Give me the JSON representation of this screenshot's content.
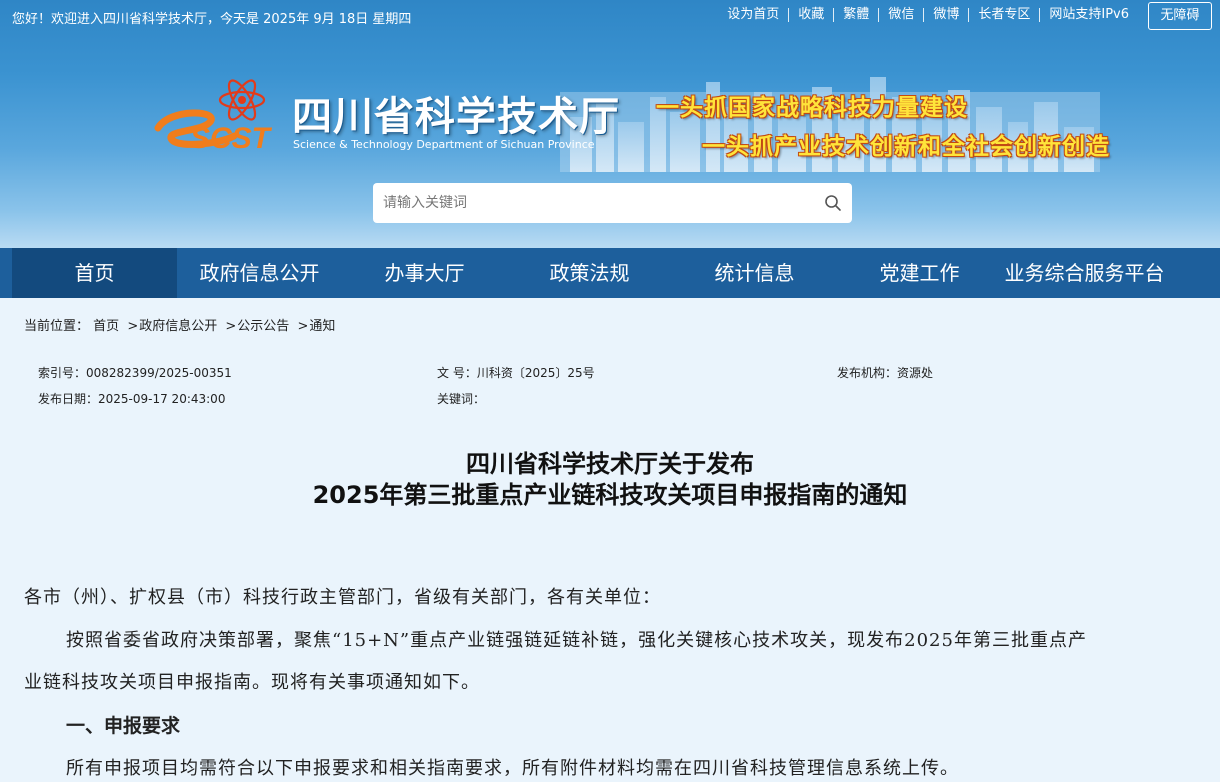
{
  "topbar": {
    "welcome": "您好！欢迎进入四川省科学技术厅，今天是  2025年 9月 18日  星期四",
    "links": [
      "设为首页",
      "收藏",
      "繁體",
      "微信",
      "微博",
      "长者专区",
      "网站支持IPv6"
    ],
    "accessibility": "无障碍"
  },
  "header": {
    "logo_text": "SCST",
    "title": "四川省科学技术厅",
    "subtitle": "Science & Technology Department of Sichuan Province",
    "slogan1": "一头抓国家战略科技力量建设",
    "slogan2": "一头抓产业技术创新和全社会创新创造"
  },
  "search": {
    "placeholder": "请输入关键词",
    "icon": "search-icon"
  },
  "nav": {
    "items": [
      "首页",
      "政府信息公开",
      "办事大厅",
      "政策法规",
      "统计信息",
      "党建工作",
      "业务综合服务平台"
    ],
    "active": "首页"
  },
  "breadcrumb": {
    "label": "当前位置：",
    "items": [
      "首页",
      "政府信息公开",
      "公示公告",
      "通知"
    ]
  },
  "meta": {
    "index_no": "索引号：008282399/2025-00351",
    "doc_no": "文 号：川科资〔2025〕25号",
    "publisher": "发布机构：资源处",
    "date": "发布日期：2025-09-17 20:43:00",
    "keywords": "关键词："
  },
  "document": {
    "title_line1": "四川省科学技术厅关于发布",
    "title_line2": "2025年第三批重点产业链科技攻关项目申报指南的通知",
    "salutation": "各市（州）、扩权县（市）科技行政主管部门，省级有关部门，各有关单位：",
    "para1_line1": "按照省委省政府决策部署，聚焦“15+N”重点产业链强链延链补链，强化关键核心技术攻关，现发布2025年第三批重点产",
    "para1_line2": "业链科技攻关项目申报指南。现将有关事项通知如下。",
    "section1": "一、申报要求",
    "para2": "所有申报项目均需符合以下申报要求和相关指南要求，所有附件材料均需在四川省科技管理信息系统上传。"
  },
  "colors": {
    "nav_bg": "#1d5f9c",
    "nav_active": "#134a7e",
    "page_bg": "#eaf4fc",
    "slogan": "#ffe43a"
  }
}
